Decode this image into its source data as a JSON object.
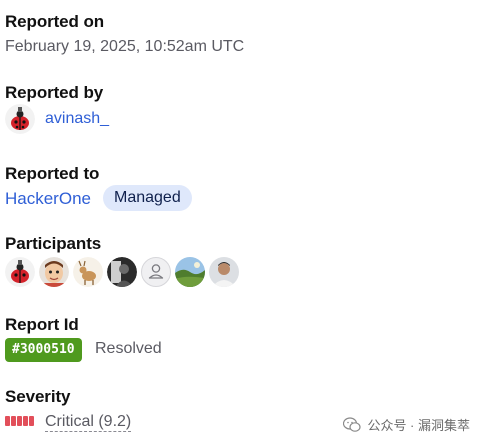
{
  "reported_on": {
    "label": "Reported on",
    "value": "February 19, 2025, 10:52am UTC"
  },
  "reported_by": {
    "label": "Reported by",
    "username": "avinash_"
  },
  "reported_to": {
    "label": "Reported to",
    "program": "HackerOne",
    "badge": "Managed"
  },
  "participants": {
    "label": "Participants",
    "avatars": [
      "ladybug-avatar",
      "cartoon-face-avatar",
      "deer-avatar",
      "dark-portrait-avatar",
      "default-user-avatar",
      "landscape-avatar",
      "person-portrait-avatar"
    ]
  },
  "report_id": {
    "label": "Report Id",
    "id": "#3000510",
    "status": "Resolved"
  },
  "severity": {
    "label": "Severity",
    "value": "Critical (9.2)",
    "level_segments": 5,
    "color": "#e24f5a"
  },
  "watermark": {
    "text": "公众号 · 漏洞集萃"
  },
  "colors": {
    "link": "#2f5fd6",
    "resolved_badge": "#4f9a1e",
    "managed_badge_bg": "#dfe8fb"
  }
}
